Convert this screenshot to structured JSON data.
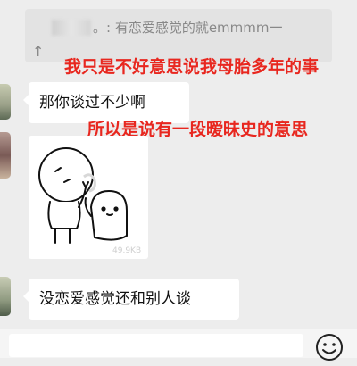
{
  "quote": {
    "sender": "",
    "text": "。: 有恋爱感觉的就emmmm一",
    "collapse_icon": "up-arrow-icon",
    "collapse_glyph": "↑"
  },
  "annotations": [
    {
      "text": "我只是不好意思说我母胎多年的事"
    },
    {
      "text": "所以是说有一段暧昧史的意思"
    }
  ],
  "messages": [
    {
      "type": "text",
      "text": "那你谈过不少啊"
    },
    {
      "type": "sticker",
      "size_label": "49.9KB"
    },
    {
      "type": "text",
      "text": "没恋爱感觉还和别人谈"
    }
  ],
  "input": {
    "value": "",
    "emoji_icon": "smiley-face-icon"
  },
  "colors": {
    "background": "#ededed",
    "bubble": "#ffffff",
    "annotation": "#e8271f"
  }
}
